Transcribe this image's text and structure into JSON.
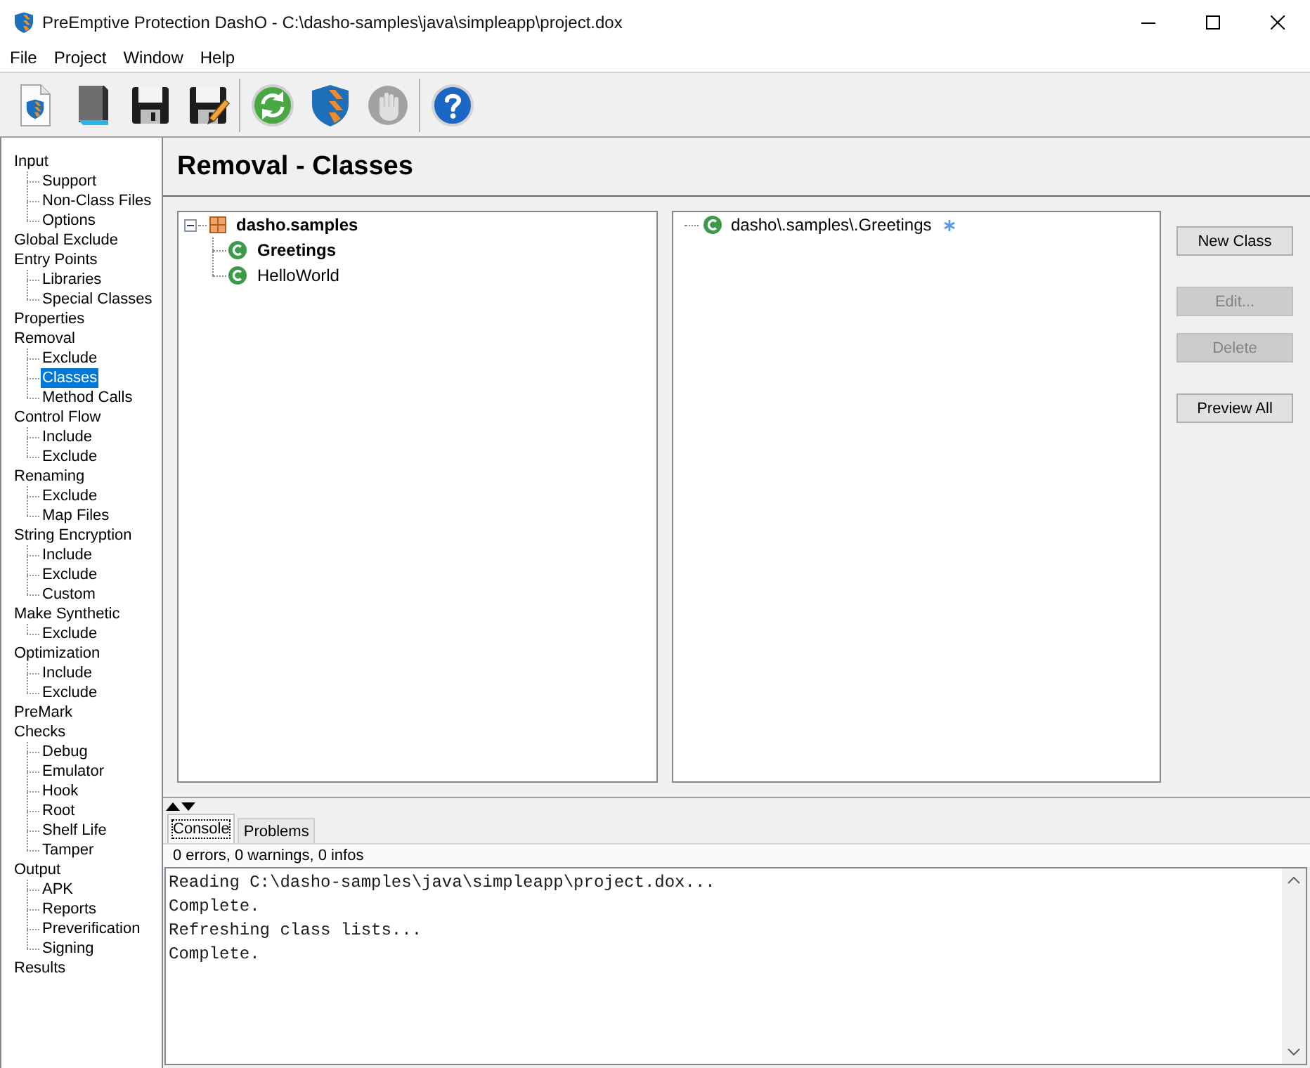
{
  "window": {
    "title": "PreEmptive Protection DashO - C:\\dasho-samples\\java\\simpleapp\\project.dox"
  },
  "menu": [
    {
      "label": "File"
    },
    {
      "label": "Project"
    },
    {
      "label": "Window"
    },
    {
      "label": "Help"
    }
  ],
  "toolbar": [
    [
      {
        "kind": "new",
        "disabled": false
      },
      {
        "kind": "open",
        "disabled": false
      },
      {
        "kind": "save",
        "disabled": false
      },
      {
        "kind": "save_as",
        "disabled": false
      }
    ],
    [
      {
        "kind": "refresh",
        "disabled": false
      },
      {
        "kind": "build",
        "disabled": false
      },
      {
        "kind": "stop",
        "disabled": true
      }
    ],
    [
      {
        "kind": "help",
        "disabled": false
      }
    ]
  ],
  "sidebar": {
    "items": [
      {
        "label": "Input",
        "selected": false,
        "children": [
          {
            "label": "Support",
            "selected": false
          },
          {
            "label": "Non-Class Files",
            "selected": false
          },
          {
            "label": "Options",
            "selected": false
          }
        ]
      },
      {
        "label": "Global Exclude",
        "selected": false
      },
      {
        "label": "Entry Points",
        "selected": false,
        "children": [
          {
            "label": "Libraries",
            "selected": false
          },
          {
            "label": "Special Classes",
            "selected": false
          }
        ]
      },
      {
        "label": "Properties",
        "selected": false
      },
      {
        "label": "Removal",
        "selected": false,
        "children": [
          {
            "label": "Exclude",
            "selected": false
          },
          {
            "label": "Classes",
            "selected": true
          },
          {
            "label": "Method Calls",
            "selected": false
          }
        ]
      },
      {
        "label": "Control Flow",
        "selected": false,
        "children": [
          {
            "label": "Include",
            "selected": false
          },
          {
            "label": "Exclude",
            "selected": false
          }
        ]
      },
      {
        "label": "Renaming",
        "selected": false,
        "children": [
          {
            "label": "Exclude",
            "selected": false
          },
          {
            "label": "Map Files",
            "selected": false
          }
        ]
      },
      {
        "label": "String Encryption",
        "selected": false,
        "children": [
          {
            "label": "Include",
            "selected": false
          },
          {
            "label": "Exclude",
            "selected": false
          },
          {
            "label": "Custom",
            "selected": false
          }
        ]
      },
      {
        "label": "Make Synthetic",
        "selected": false,
        "children": [
          {
            "label": "Exclude",
            "selected": false
          }
        ]
      },
      {
        "label": "Optimization",
        "selected": false,
        "children": [
          {
            "label": "Include",
            "selected": false
          },
          {
            "label": "Exclude",
            "selected": false
          }
        ]
      },
      {
        "label": "PreMark",
        "selected": false
      },
      {
        "label": "Checks",
        "selected": false,
        "children": [
          {
            "label": "Debug",
            "selected": false
          },
          {
            "label": "Emulator",
            "selected": false
          },
          {
            "label": "Hook",
            "selected": false
          },
          {
            "label": "Root",
            "selected": false
          },
          {
            "label": "Shelf Life",
            "selected": false
          },
          {
            "label": "Tamper",
            "selected": false
          }
        ]
      },
      {
        "label": "Output",
        "selected": false,
        "children": [
          {
            "label": "APK",
            "selected": false
          },
          {
            "label": "Reports",
            "selected": false
          },
          {
            "label": "Preverification",
            "selected": false
          },
          {
            "label": "Signing",
            "selected": false
          }
        ]
      },
      {
        "label": "Results",
        "selected": false
      }
    ]
  },
  "page": {
    "title": "Removal - Classes"
  },
  "class_tree": {
    "label": "dasho.samples",
    "expanded": true,
    "children": [
      {
        "label": "Greetings",
        "emphasized": true
      },
      {
        "label": "HelloWorld",
        "emphasized": false
      }
    ]
  },
  "rules": [
    {
      "pattern": "dasho\\.samples\\.Greetings",
      "marked": true
    }
  ],
  "buttons": [
    [
      {
        "label": "New Class",
        "disabled": false
      }
    ],
    [
      {
        "label": "Edit...",
        "disabled": true
      },
      {
        "label": "Delete",
        "disabled": true
      }
    ],
    [
      {
        "label": "Preview All",
        "disabled": false
      }
    ]
  ],
  "console": {
    "tabs": [
      {
        "label": "Console",
        "selected": true
      },
      {
        "label": "Problems",
        "selected": false
      }
    ],
    "summary": "0 errors, 0 warnings, 0 infos",
    "lines": [
      "Reading C:\\dasho-samples\\java\\simpleapp\\project.dox...",
      "Complete.",
      "Refreshing class lists...",
      "Complete."
    ]
  }
}
